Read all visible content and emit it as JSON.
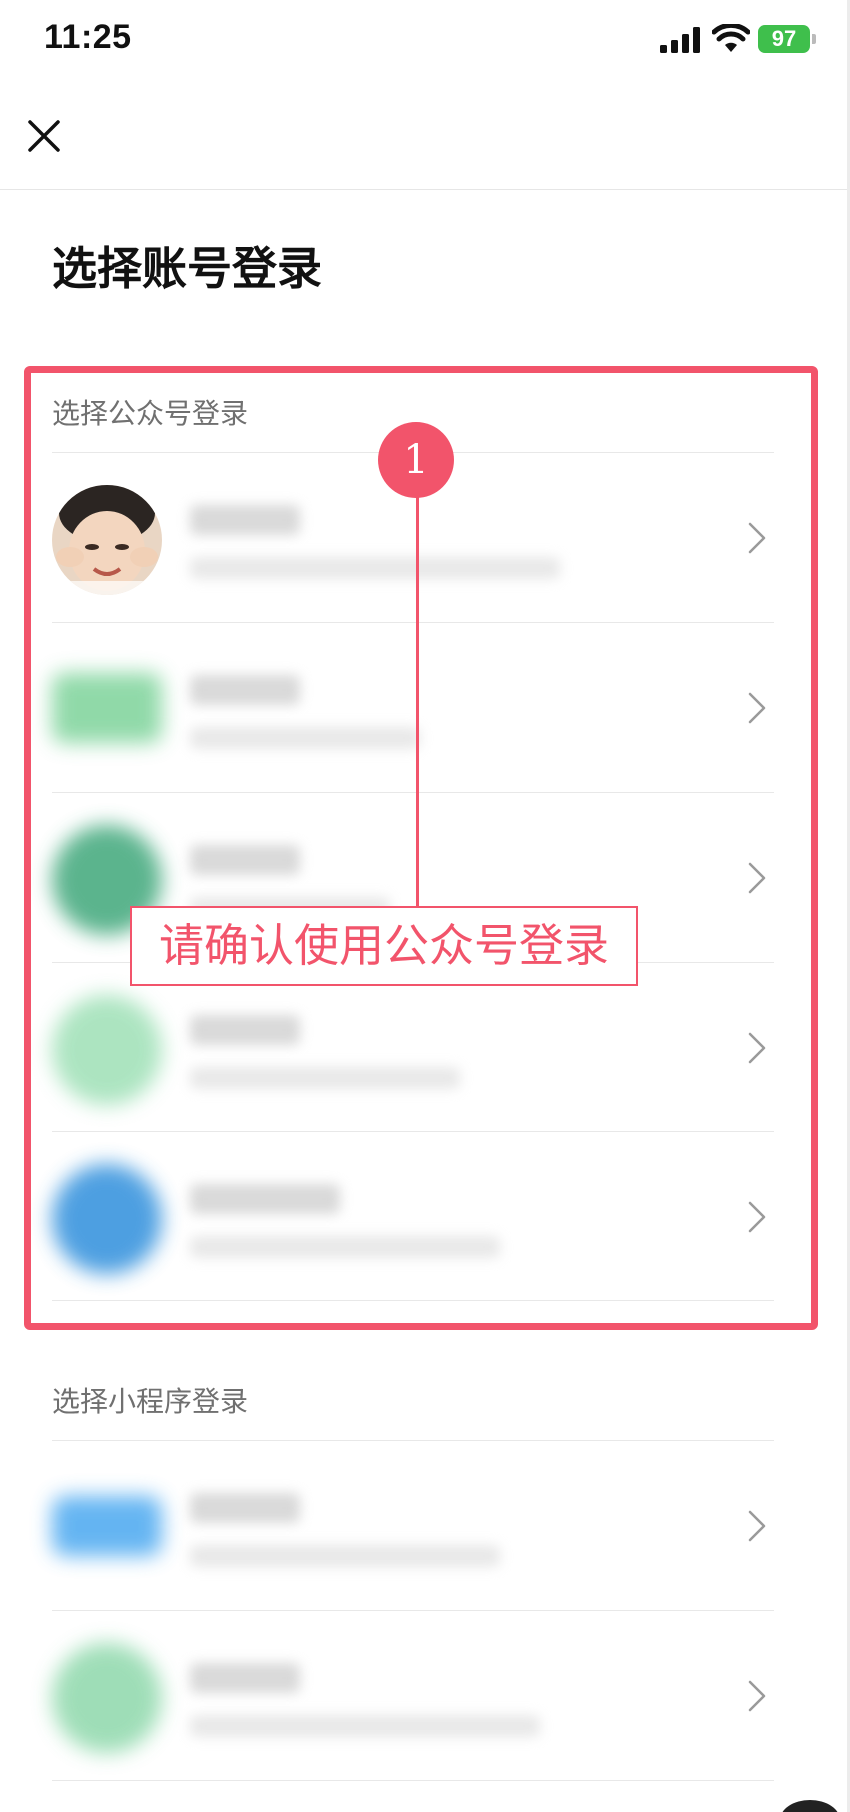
{
  "status_bar": {
    "time": "11:25",
    "battery": "97"
  },
  "nav": {
    "close_icon": "close-icon"
  },
  "page": {
    "title": "选择账号登录"
  },
  "official_accounts": {
    "label": "选择公众号登录",
    "avatar_colors": [
      "#f2d9c4",
      "#7dd39a",
      "#3fa77a",
      "#9ee0b6",
      "#2f8fdc"
    ]
  },
  "mini_programs": {
    "label": "选择小程序登录",
    "avatar_colors": [
      "#4aa8f0",
      "#8ed8ab"
    ]
  },
  "annotation": {
    "step_number": "1",
    "label": "请确认使用公众号登录",
    "color": "#f2546b"
  }
}
